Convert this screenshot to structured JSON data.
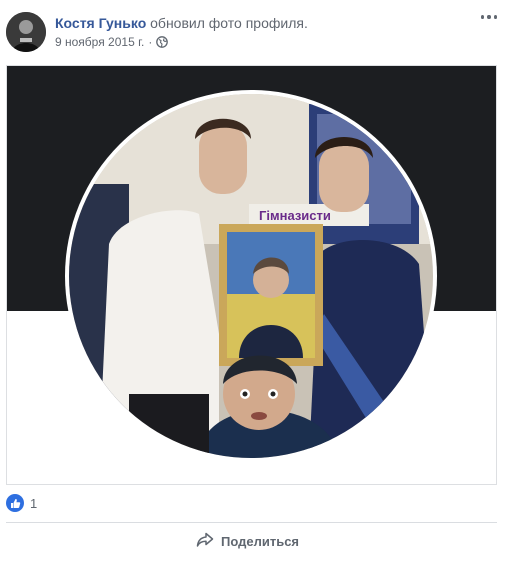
{
  "post": {
    "author": "Костя Гунько",
    "action": "обновил фото профиля.",
    "date": "9 ноября 2015 г.",
    "separator": "·",
    "privacy_icon": "globe-icon",
    "photo_caption_sign": "Гімназисти"
  },
  "reactions": {
    "icon": "like-icon",
    "count": "1"
  },
  "actions": {
    "share_label": "Поделиться",
    "share_icon": "share-arrow-icon"
  },
  "colors": {
    "link": "#365899",
    "muted": "#616770",
    "like_blue": "#2e6fe0",
    "cover": "#1c1e21"
  }
}
